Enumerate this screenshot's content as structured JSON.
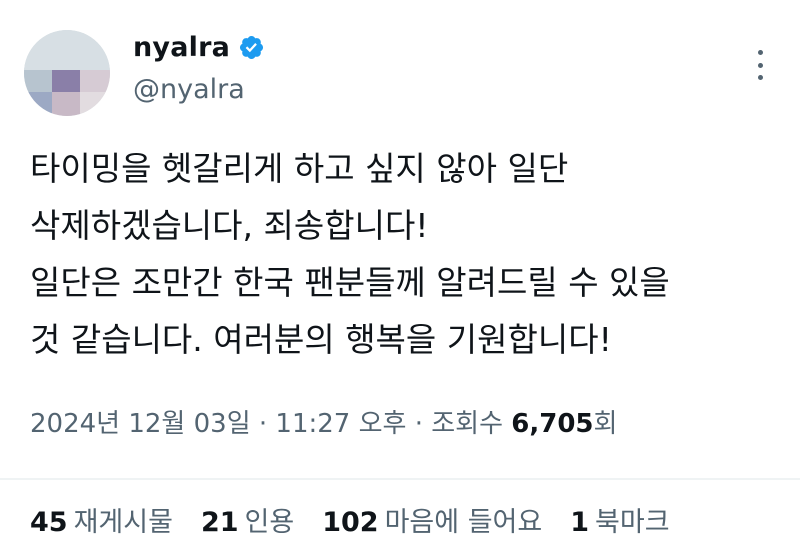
{
  "author": {
    "display_name": "nyalra",
    "handle": "@nyalra",
    "verified_color": "#1d9bf0"
  },
  "tweet": {
    "text": "타이밍을 헷갈리게 하고 싶지 않아 일단\n삭제하겠습니다, 죄송합니다!\n일단은 조만간 한국 팬분들께 알려드릴 수 있을\n것 같습니다. 여러분의 행복을 기원합니다!",
    "timestamp": "2024년 12월 03일 · 11:27 오후 · 조회수 ",
    "views": "6,705",
    "views_suffix": "회"
  },
  "stats": [
    {
      "count": "45",
      "label": "재게시물"
    },
    {
      "count": "21",
      "label": "인용"
    },
    {
      "count": "102",
      "label": "마음에 들어요"
    },
    {
      "count": "1",
      "label": "북마크"
    }
  ]
}
